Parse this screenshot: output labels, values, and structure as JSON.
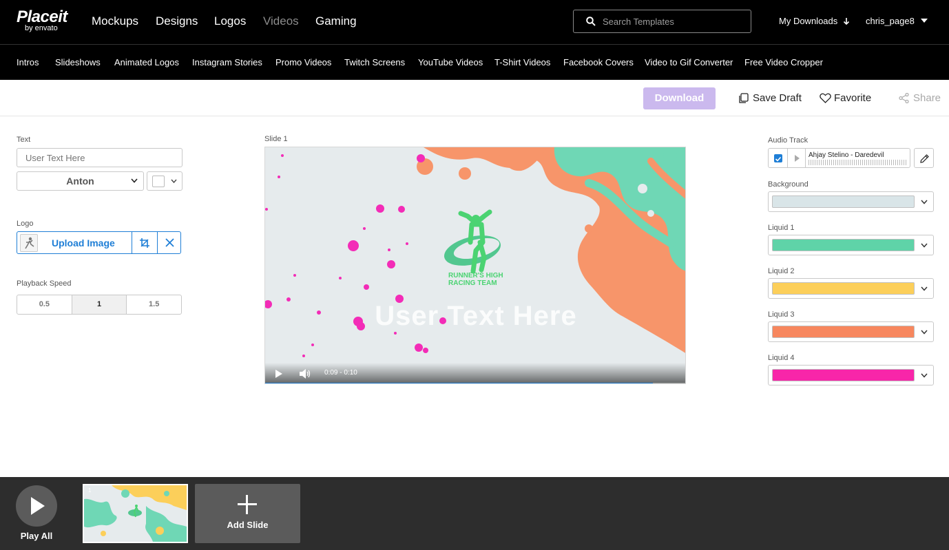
{
  "brand": {
    "name": "Placeit",
    "sub": "by envato"
  },
  "topnav": {
    "items": [
      {
        "label": "Mockups"
      },
      {
        "label": "Designs"
      },
      {
        "label": "Logos"
      },
      {
        "label": "Videos"
      },
      {
        "label": "Gaming"
      }
    ],
    "search_placeholder": "Search Templates",
    "my_downloads": "My Downloads",
    "username": "chris_page8"
  },
  "subnav": {
    "items": [
      {
        "label": "Intros"
      },
      {
        "label": "Slideshows"
      },
      {
        "label": "Animated Logos"
      },
      {
        "label": "Instagram Stories"
      },
      {
        "label": "Promo Videos"
      },
      {
        "label": "Twitch Screens"
      },
      {
        "label": "YouTube Videos"
      },
      {
        "label": "T-Shirt Videos"
      },
      {
        "label": "Facebook Covers"
      },
      {
        "label": "Video to Gif Converter"
      },
      {
        "label": "Free Video Cropper"
      }
    ]
  },
  "actions": {
    "download": "Download",
    "save_draft": "Save Draft",
    "favorite": "Favorite",
    "share": "Share"
  },
  "left_panel": {
    "text_label": "Text",
    "text_placeholder": "User Text Here",
    "font": "Anton",
    "text_color": "#ffffff",
    "logo_label": "Logo",
    "upload_label": "Upload Image",
    "speed_label": "Playback Speed",
    "speeds": [
      "0.5",
      "1",
      "1.5"
    ],
    "selected_speed": "1"
  },
  "preview": {
    "slide_label": "Slide 1",
    "overlay_text": "User Text Here",
    "logo_line1": "RUNNER'S HIGH",
    "logo_line2": "RACING TEAM",
    "time": "0:09 - 0:10",
    "progress": 0.92
  },
  "right_panel": {
    "audio_label": "Audio Track",
    "audio_checked": true,
    "audio_track": "Ahjay Stelino - Daredevil",
    "fields": [
      {
        "label": "Background",
        "color": "#d9e5e8"
      },
      {
        "label": "Liquid 1",
        "color": "#5fd3a8"
      },
      {
        "label": "Liquid 2",
        "color": "#fccf5a"
      },
      {
        "label": "Liquid 3",
        "color": "#f7875e"
      },
      {
        "label": "Liquid 4",
        "color": "#f826a9"
      }
    ]
  },
  "bottom": {
    "play_all": "Play All",
    "add_slide": "Add Slide",
    "slide_number": "1"
  },
  "colors": {
    "accent": "#1e7ed6",
    "download_disabled": "#cbb9ee",
    "liquid_orange": "#f7956a",
    "liquid_teal": "#6fd7b5",
    "dots": "#f32cb7"
  }
}
